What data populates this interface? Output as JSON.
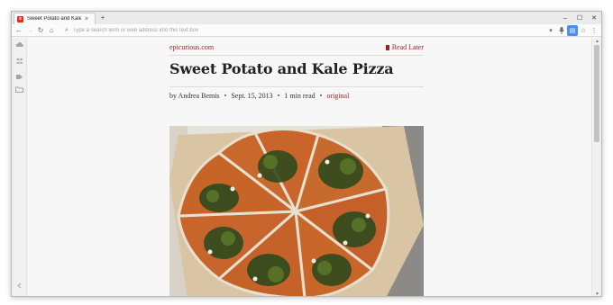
{
  "tab": {
    "title": "Sweet Potato and Kale...",
    "close": "×",
    "favicon_letter": "e"
  },
  "newtab": "+",
  "window_controls": {
    "minimize": "–",
    "maximize": "☐",
    "close": "✕"
  },
  "nav": {
    "back": "←",
    "forward": "→",
    "reload": "↻",
    "home": "⌂"
  },
  "omnibox": {
    "placeholder": "Type a search term or web address into this text box",
    "search_icon": "⌕"
  },
  "toolbar_icons": {
    "dropdown": "▾",
    "mic": "🎤",
    "reading_view": "▤",
    "favorite": "☆",
    "menu": "⋮"
  },
  "side_icons": [
    "cloud-icon",
    "people-icon",
    "tag-icon",
    "folder-icon",
    "collapse-icon"
  ],
  "article": {
    "site": "epicurious.com",
    "read_later": "Read Later",
    "title": "Sweet Potato and Kale Pizza",
    "author": "by Andrea Bemis",
    "date": "Sept. 15, 2013",
    "read_time": "1 min read",
    "original": "original",
    "separator": "•"
  },
  "scrollbar": {
    "up": "▲",
    "down": "▼"
  },
  "colors": {
    "accent": "#9b2424",
    "reading_view_active": "#4a8ef0"
  }
}
